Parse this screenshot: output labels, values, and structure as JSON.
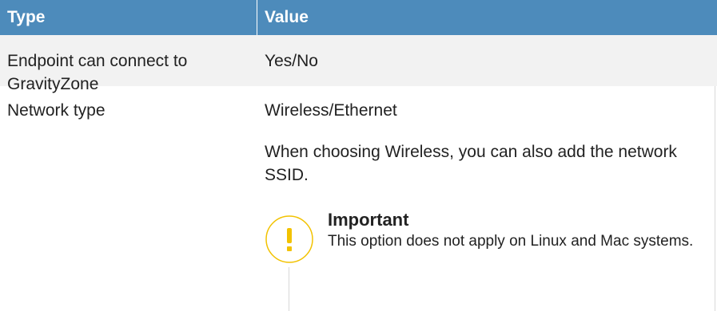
{
  "table": {
    "headers": [
      "Type",
      "Value"
    ],
    "rows": [
      {
        "type": "Endpoint can connect to GravityZone",
        "value": "Yes/No"
      },
      {
        "type": "Network type",
        "value": "Wireless/Ethernet",
        "value_extra": "When choosing Wireless, you can also add the network SSID.",
        "note": {
          "title": "Important",
          "text": "This option does not apply on Linux and Mac systems.",
          "icon": "exclamation-icon",
          "icon_color": "#f2c200"
        }
      }
    ]
  },
  "colors": {
    "header_bg": "#4d8bbb",
    "row_alt": "#f2f2f2"
  }
}
